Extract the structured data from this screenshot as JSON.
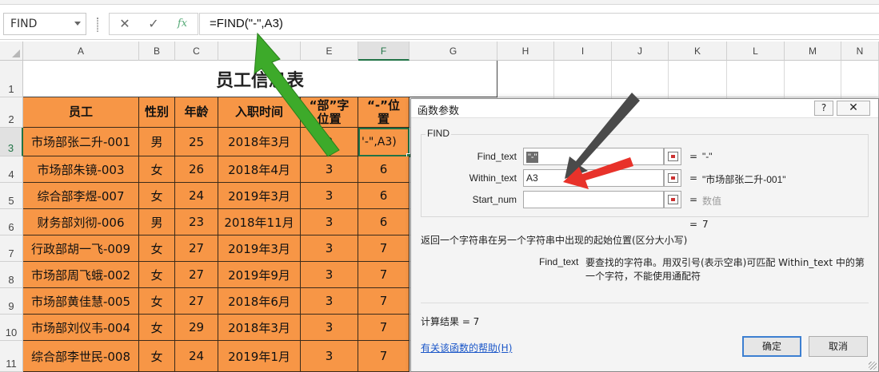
{
  "formula_bar": {
    "name_box": "FIND",
    "formula": "=FIND(\"-\",A3)",
    "fx_label": "fx",
    "cancel_glyph": "✕",
    "enter_glyph": "✓"
  },
  "columns": [
    "A",
    "B",
    "C",
    "D",
    "E",
    "F",
    "G",
    "H",
    "I",
    "J",
    "K",
    "L",
    "M",
    "N"
  ],
  "rows": [
    "1",
    "2",
    "3",
    "4",
    "5",
    "6",
    "7",
    "8",
    "9",
    "10",
    "11"
  ],
  "sheet": {
    "title": "员工信息表",
    "headers": [
      "员工",
      "性别",
      "年龄",
      "入职时间",
      "“部”字\n位置",
      "“-”位\n置"
    ],
    "data": [
      [
        "市场部张二升-001",
        "男",
        "25",
        "2018年3月",
        "3",
        "'-\",A3)"
      ],
      [
        "市场部朱镜-003",
        "女",
        "26",
        "2018年4月",
        "3",
        "6"
      ],
      [
        "综合部李煜-007",
        "女",
        "24",
        "2019年3月",
        "3",
        "6"
      ],
      [
        "财务部刘彻-006",
        "男",
        "23",
        "2018年11月",
        "3",
        "6"
      ],
      [
        "行政部胡一飞-009",
        "女",
        "27",
        "2019年3月",
        "3",
        "7"
      ],
      [
        "市场部周飞蛾-002",
        "女",
        "27",
        "2019年9月",
        "3",
        "7"
      ],
      [
        "市场部黄佳慧-005",
        "女",
        "27",
        "2018年6月",
        "3",
        "7"
      ],
      [
        "市场部刘仪韦-004",
        "女",
        "29",
        "2018年3月",
        "3",
        "7"
      ],
      [
        "综合部李世民-008",
        "女",
        "24",
        "2019年1月",
        "3",
        "7"
      ]
    ]
  },
  "dialog": {
    "title": "函数参数",
    "help_button": "?",
    "close_button": "✕",
    "function_name": "FIND",
    "args": [
      {
        "label": "Find_text",
        "value": "\"-\"",
        "eq": "=",
        "result": "\"-\""
      },
      {
        "label": "Within_text",
        "value": "A3",
        "eq": "=",
        "result": "\"市场部张二升-001\""
      },
      {
        "label": "Start_num",
        "value": "",
        "eq": "=",
        "result": "数值"
      }
    ],
    "result_eq": "=",
    "result_value": "7",
    "description": "返回一个字符串在另一个字符串中出现的起始位置(区分大小写)",
    "arg_name": "Find_text",
    "arg_description": "要查找的字符串。用双引号(表示空串)可匹配 Within_text 中的第一个字符，不能使用通配符",
    "calc_result": "计算结果 =   7",
    "help_link": "有关该函数的帮助(H)",
    "ok_button": "确定",
    "cancel_button": "取消"
  },
  "colors": {
    "header_fill": "#F79646",
    "active_green": "#217346",
    "arrow_green": "#3DAA2A",
    "arrow_red": "#E8322A",
    "arrow_gray": "#4A4A4A"
  }
}
